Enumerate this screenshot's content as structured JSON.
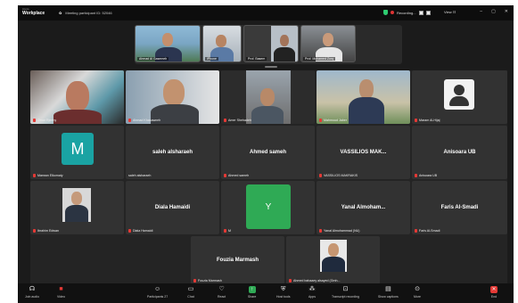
{
  "titlebar": {
    "brand_top": "zoom",
    "brand_name": "Workplace",
    "meeting_info": "Meeting participant ID: 52046",
    "recording": "Recording...",
    "view": "View"
  },
  "strip": [
    {
      "label": "Ahmad Al Gasemeh"
    },
    {
      "label": "iPhone"
    },
    {
      "label": "Prof. Basem"
    },
    {
      "label": "Prof. Mohamed Zorq"
    }
  ],
  "tiles": [
    {
      "label": "Omar Rjeehy",
      "name": ""
    },
    {
      "label": "Ahmad Khasawneh",
      "name": ""
    },
    {
      "label": "Amer Shehadeh",
      "name": ""
    },
    {
      "label": "Mahmoud Jaber",
      "name": ""
    },
    {
      "label": "Maram Al-Hijaj",
      "name": ""
    },
    {
      "label": "Marwan Elkomaty",
      "name": "",
      "avatar": "M"
    },
    {
      "label": "saleh alsharaeh",
      "name": "saleh alsharaeh"
    },
    {
      "label": "Ahmed sameh",
      "name": "Ahmed sameh"
    },
    {
      "label": "VASSILIOS MAKRAKIS",
      "name": "VASSILIOS MAK..."
    },
    {
      "label": "Anisoara UB",
      "name": "Anisoara UB"
    },
    {
      "label": "Ibrahim Edwan",
      "name": ""
    },
    {
      "label": "Diala Hamaidi",
      "name": "Diala Hamaidi"
    },
    {
      "label": "M",
      "name": "",
      "avatar": "Y"
    },
    {
      "label": "Yanal Almohammad (NU)",
      "name": "Yanal  Almoham..."
    },
    {
      "label": "Faris Al-Smadi",
      "name": "Faris Al-Smadi"
    },
    {
      "label": "Fouzia Marmash",
      "name": "Fouzia Marmash"
    },
    {
      "label": "Ahmed bahaaey alsayed (Gmh...",
      "name": ""
    }
  ],
  "toolbar": {
    "audio": "Join audio",
    "video": "Video",
    "participants": "Participants",
    "participants_count": "27",
    "chat": "Chat",
    "react": "React",
    "share": "Share",
    "host_tools": "Host tools",
    "apps": "Apps",
    "transcript": "Transcript recording",
    "captions": "Show captions",
    "more": "More",
    "end": "End"
  }
}
